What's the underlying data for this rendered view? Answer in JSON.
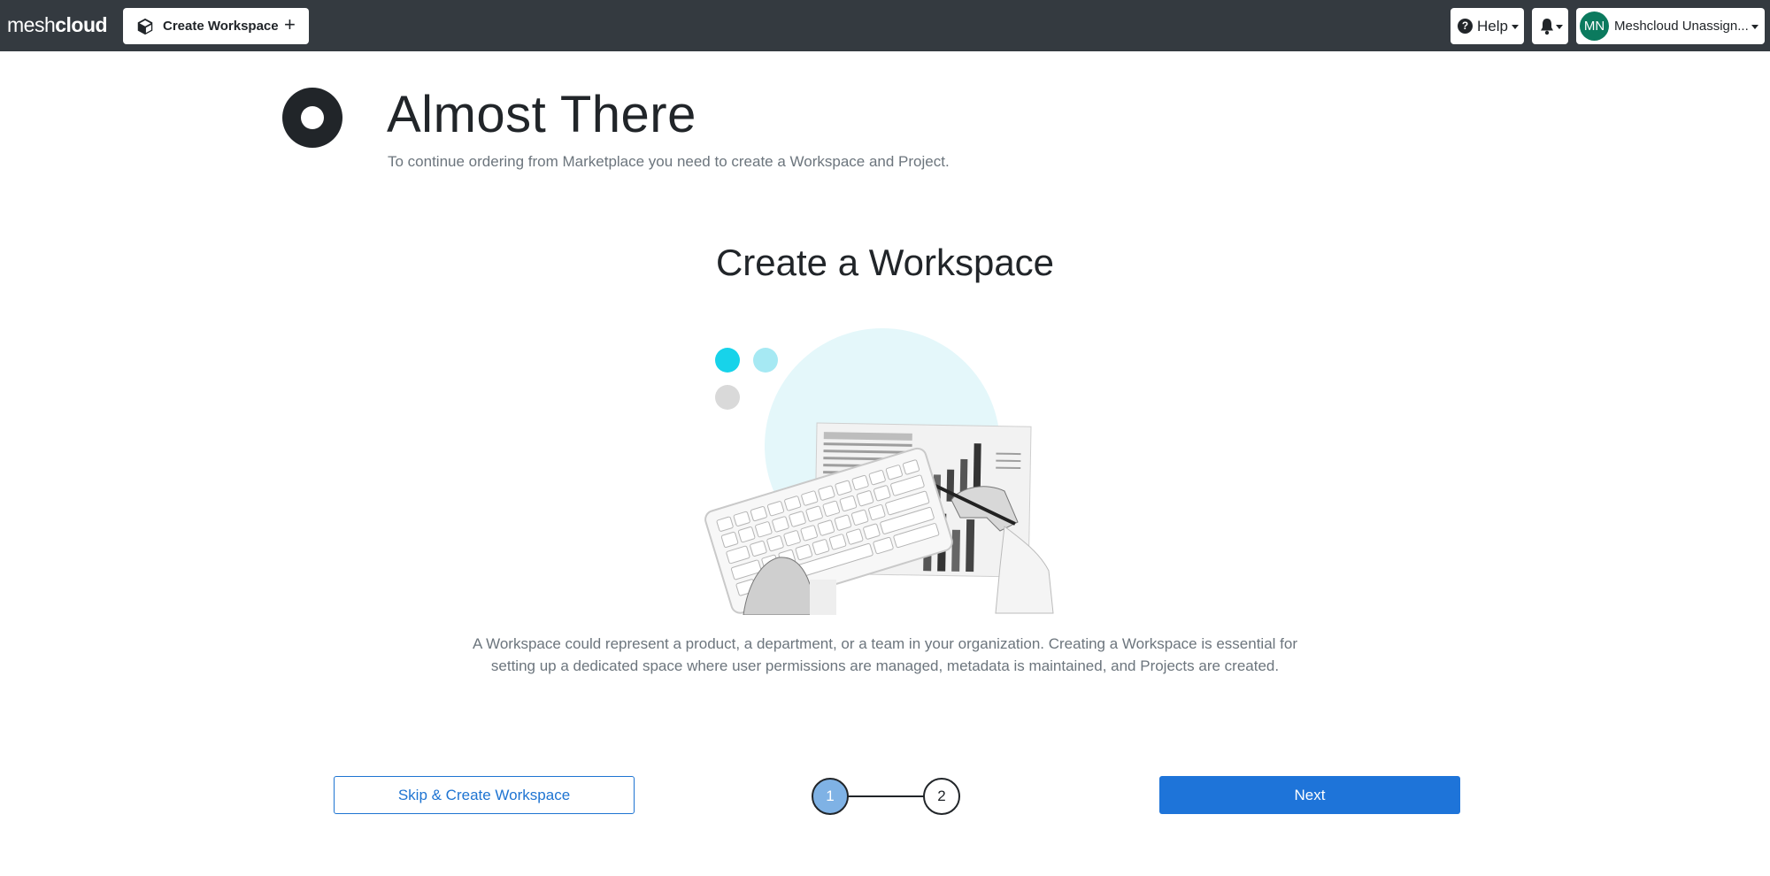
{
  "navbar": {
    "brand_light": "mesh",
    "brand_bold": "cloud",
    "tab_label": "Create Workspace",
    "tab_add": "+",
    "help_label": "Help",
    "help_icon_glyph": "?",
    "user_initials": "MN",
    "user_name": "Meshcloud Unassign..."
  },
  "header": {
    "title": "Almost There",
    "subtitle": "To continue ordering from Marketplace you need to create a Workspace and Project."
  },
  "main": {
    "section_title": "Create a Workspace",
    "description": "A Workspace could represent a product, a department, or a team in your organization. Creating a Workspace is essential for setting up a dedicated space where user permissions are managed, metadata is maintained, and Projects are created."
  },
  "footer": {
    "skip_label": "Skip & Create Workspace",
    "next_label": "Next",
    "steps": [
      "1",
      "2"
    ],
    "current_step": 1
  },
  "colors": {
    "navbar_bg": "#343a40",
    "primary": "#1e74d9",
    "avatar_bg": "#0b7a5e",
    "active_step": "#7fb2e5",
    "accent_cyan": "#17d3ea"
  },
  "icons": {
    "tab": "cube-icon",
    "help": "question-circle-icon",
    "notifications": "bell-icon",
    "status": "status-ring-icon"
  }
}
